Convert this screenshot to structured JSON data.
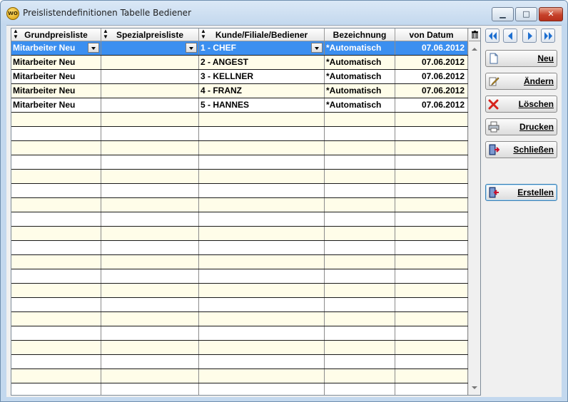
{
  "window": {
    "title": "Preislistendefinitionen Tabelle Bediener",
    "app_icon": "WO",
    "controls": {
      "minimize": "▁",
      "maximize": "□",
      "close": "✕"
    }
  },
  "table": {
    "columns": [
      "Grundpreisliste",
      "Spezialpreisliste",
      "Kunde/Filiale/Bediener",
      "Bezeichnung",
      "von Datum"
    ],
    "rows": [
      {
        "grundpreisliste": "Mitarbeiter Neu",
        "spezialpreisliste": "",
        "kunde": "1 - CHEF",
        "bezeichnung": "*Automatisch",
        "datum": "07.06.2012"
      },
      {
        "grundpreisliste": "Mitarbeiter Neu",
        "spezialpreisliste": "",
        "kunde": "2 - ANGEST",
        "bezeichnung": "*Automatisch",
        "datum": "07.06.2012"
      },
      {
        "grundpreisliste": "Mitarbeiter Neu",
        "spezialpreisliste": "",
        "kunde": "3 - KELLNER",
        "bezeichnung": "*Automatisch",
        "datum": "07.06.2012"
      },
      {
        "grundpreisliste": "Mitarbeiter Neu",
        "spezialpreisliste": "",
        "kunde": "4 - FRANZ",
        "bezeichnung": "*Automatisch",
        "datum": "07.06.2012"
      },
      {
        "grundpreisliste": "Mitarbeiter Neu",
        "spezialpreisliste": "",
        "kunde": "5 - HANNES",
        "bezeichnung": "*Automatisch",
        "datum": "07.06.2012"
      }
    ],
    "selected_row": 0,
    "corner_icon": "trash-icon"
  },
  "nav_buttons": [
    "first-record-icon",
    "previous-record-icon",
    "next-record-icon",
    "last-record-icon"
  ],
  "actions": {
    "neu": "Neu",
    "aendern": "Ändern",
    "loeschen": "Löschen",
    "drucken": "Drucken",
    "schliessen": "Schließen",
    "erstellen": "Erstellen"
  },
  "colors": {
    "selection": "#3b8ff0",
    "row_alt": "#fffde9",
    "window_frame": "#c3d8ee"
  }
}
